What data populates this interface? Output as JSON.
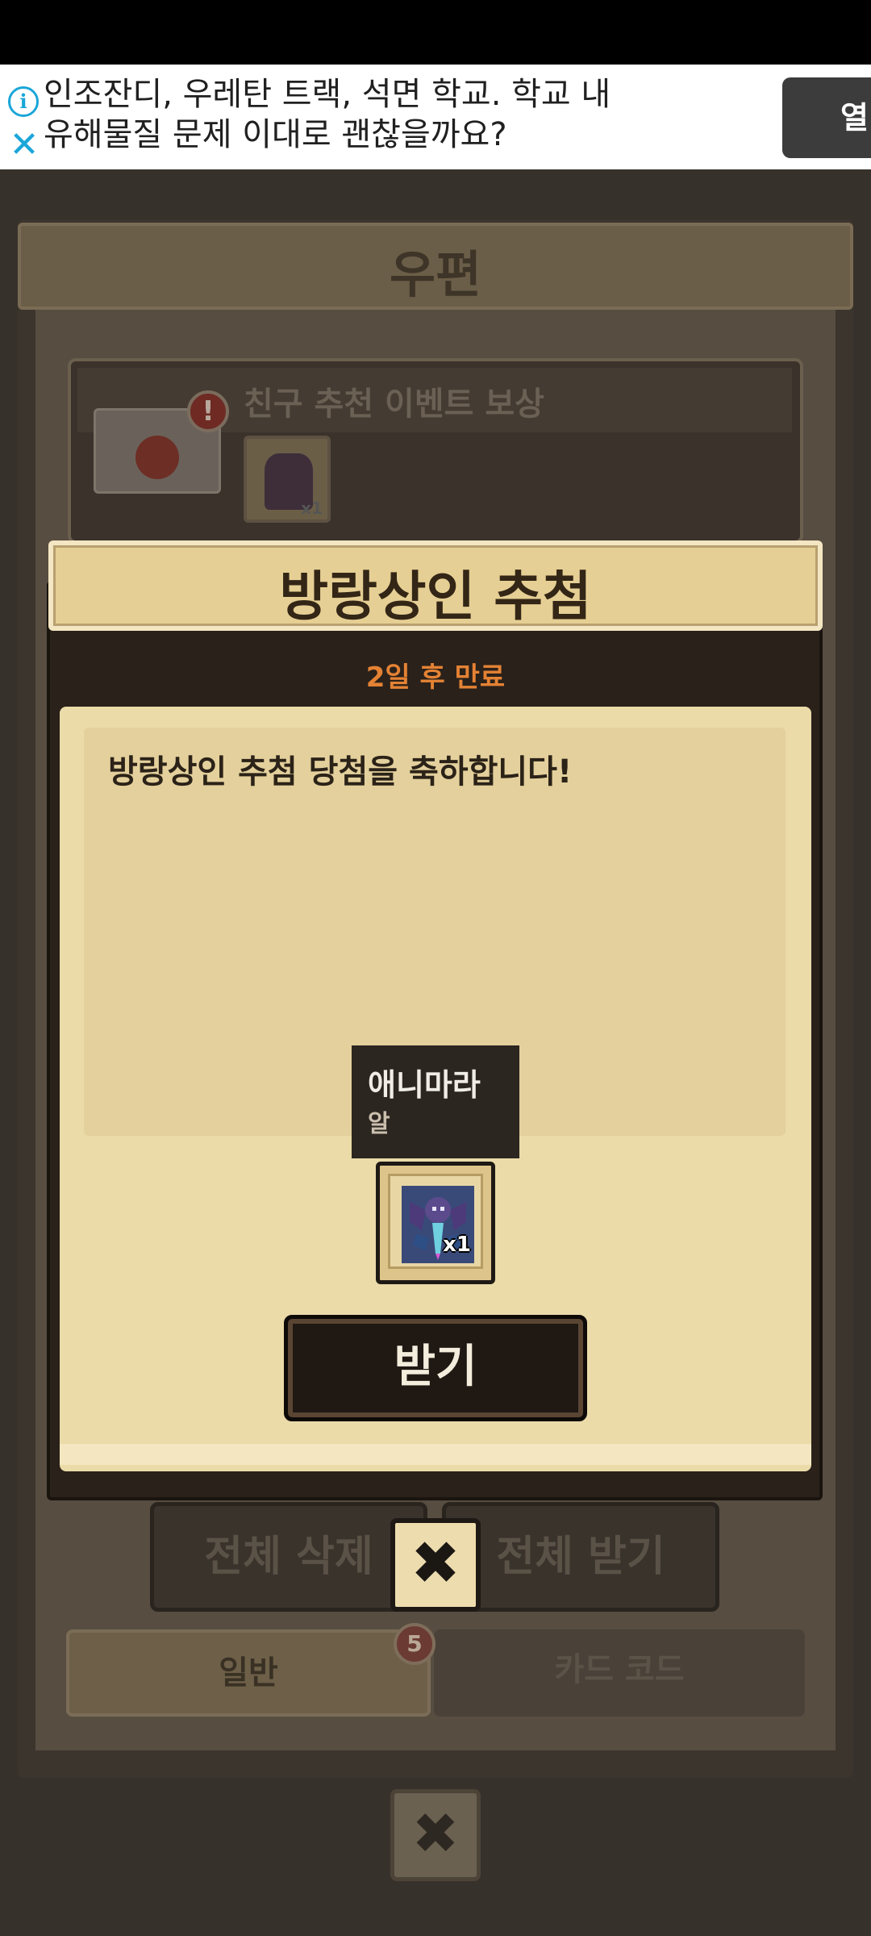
{
  "ad": {
    "text": "인조잔디, 우레탄 트랙, 석면 학교. 학교 내 유해물질 문제 이대로 괜찮을까요?",
    "button_label": "열",
    "info_icon": "info-icon",
    "close_icon": "close-icon"
  },
  "mail": {
    "title": "우편",
    "item": {
      "title": "친구 추천 이벤트 보상",
      "alert": "!",
      "quantity": "x1"
    },
    "delete_all_label": "전체 삭제",
    "receive_all_label": "전체 받기",
    "tabs": [
      {
        "label": "일반",
        "badge": "5"
      },
      {
        "label": "카드 코드"
      }
    ],
    "close_symbol": "✖"
  },
  "popup": {
    "title": "방랑상인 추첨",
    "expiry": "2일 후 만료",
    "message": "방랑상인 추첨 당첨을 축하합니다!",
    "tooltip": {
      "name": "애니마라",
      "type": "알"
    },
    "reward_quantity": "x1",
    "receive_label": "받기",
    "close_symbol": "✖"
  },
  "colors": {
    "accent_orange": "#e48234",
    "paper": "#eadba8",
    "header": "#e6cf94",
    "ad_blue": "#1aa6d8"
  }
}
